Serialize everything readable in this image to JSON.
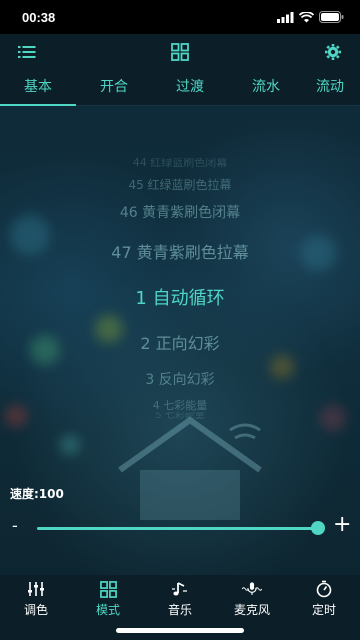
{
  "status_bar": {
    "time": "00:38"
  },
  "top_bar": {
    "menu_icon": "list-icon",
    "center_icon": "grid-icon",
    "settings_icon": "gear-icon"
  },
  "tabs": [
    {
      "label": "基本",
      "active": true
    },
    {
      "label": "开合",
      "active": false
    },
    {
      "label": "过渡",
      "active": false
    },
    {
      "label": "流水",
      "active": false
    },
    {
      "label": "流动",
      "active": false
    }
  ],
  "picker": {
    "items": [
      {
        "label": "44 红绿蓝刷色闭幕"
      },
      {
        "label": "45 红绿蓝刷色拉幕"
      },
      {
        "label": "46 黄青紫刷色闭幕"
      },
      {
        "label": "47 黄青紫刷色拉幕"
      },
      {
        "label": "1 自动循环"
      },
      {
        "label": "2 正向幻彩"
      },
      {
        "label": "3 反向幻彩"
      },
      {
        "label": "4 七彩能量"
      },
      {
        "label": "5 七彩能量"
      }
    ],
    "selected": "1 自动循环"
  },
  "speed": {
    "label": "速度:100",
    "value": 100,
    "minus": "-",
    "plus": "+"
  },
  "bottom_nav": [
    {
      "label": "调色",
      "icon": "sliders-icon",
      "active": false
    },
    {
      "label": "模式",
      "icon": "grid-icon",
      "active": true
    },
    {
      "label": "音乐",
      "icon": "music-note-icon",
      "active": false
    },
    {
      "label": "麦克风",
      "icon": "microphone-icon",
      "active": false
    },
    {
      "label": "定时",
      "icon": "timer-icon",
      "active": false
    }
  ],
  "colors": {
    "accent": "#4fd6c4",
    "bar": "#0c1f28"
  }
}
